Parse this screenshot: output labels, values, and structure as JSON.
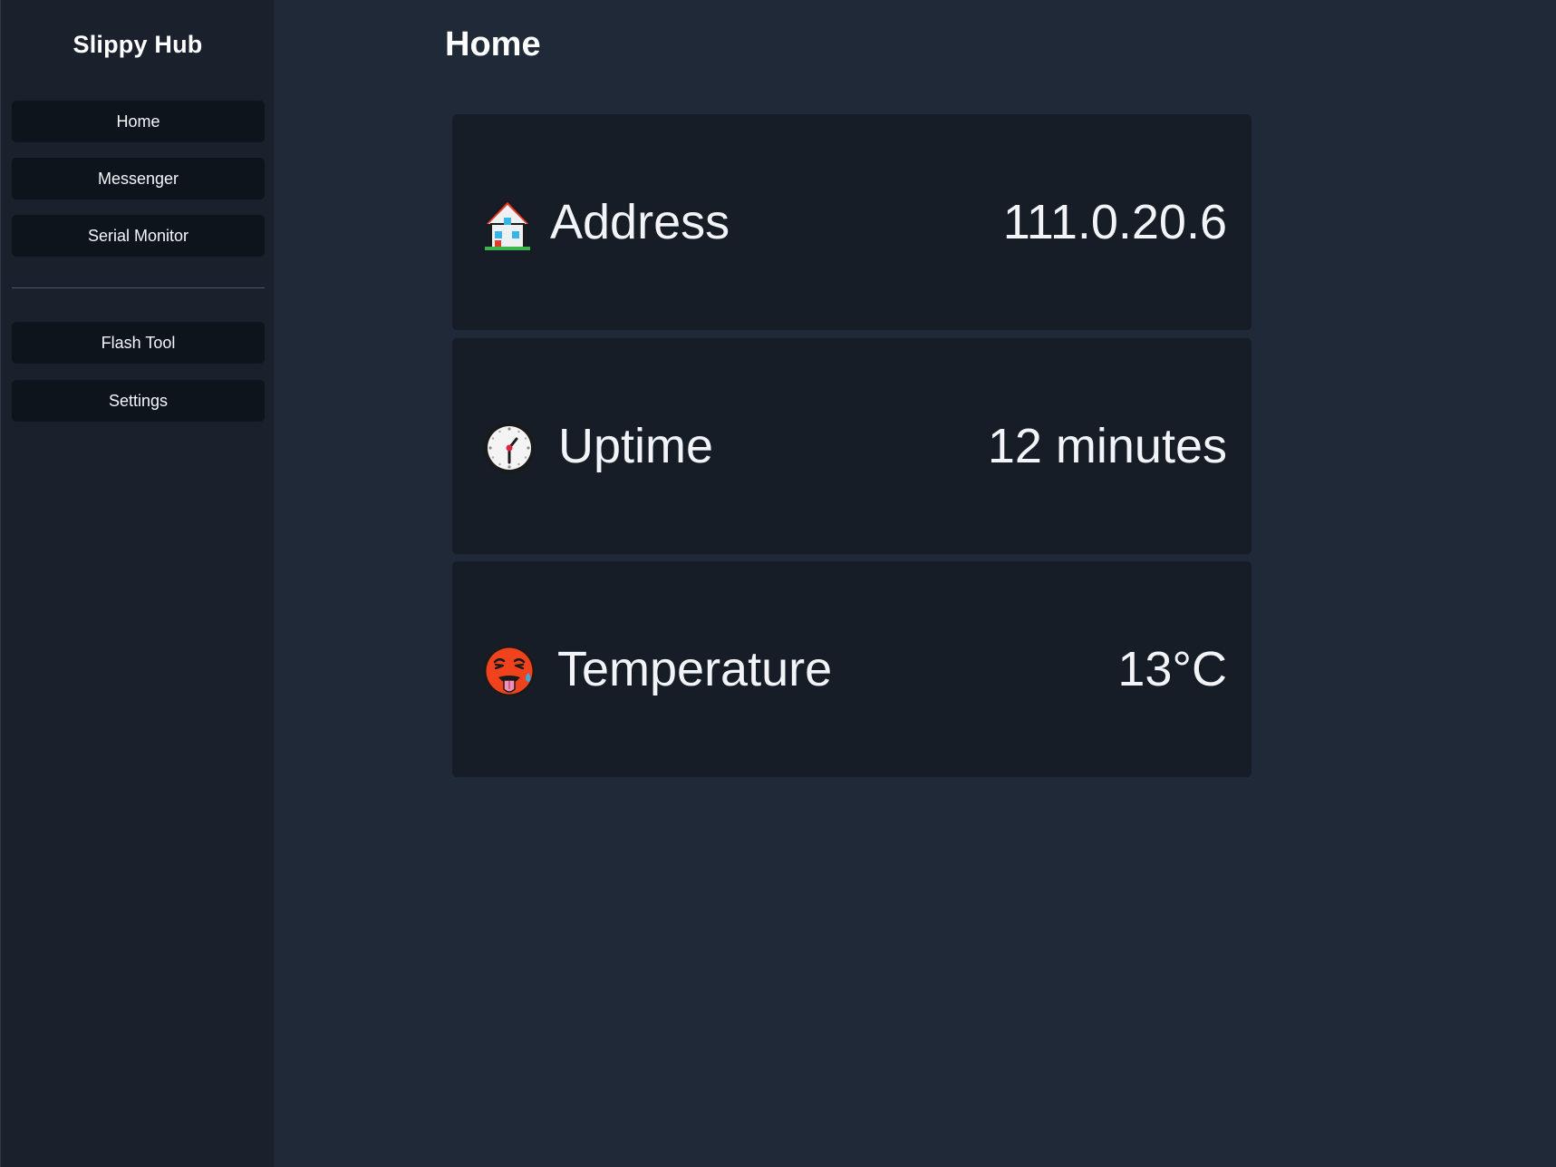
{
  "sidebar": {
    "brand": "Slippy Hub",
    "nav": [
      {
        "label": "Home"
      },
      {
        "label": "Messenger"
      },
      {
        "label": "Serial Monitor"
      }
    ],
    "tools": [
      {
        "label": "Flash Tool"
      },
      {
        "label": "Settings"
      }
    ]
  },
  "main": {
    "title": "Home",
    "cards": [
      {
        "icon": "house-icon",
        "label": "Address",
        "value": "111.0.20.6"
      },
      {
        "icon": "clock-icon",
        "label": "Uptime",
        "value": "12 minutes"
      },
      {
        "icon": "hot-face-icon",
        "label": "Temperature",
        "value": "13°C"
      }
    ]
  },
  "colors": {
    "page_background": "#1f2937",
    "sidebar_background": "#1a202c",
    "button_background": "#0d141c",
    "card_background": "#161d27",
    "text": "#ffffff"
  }
}
